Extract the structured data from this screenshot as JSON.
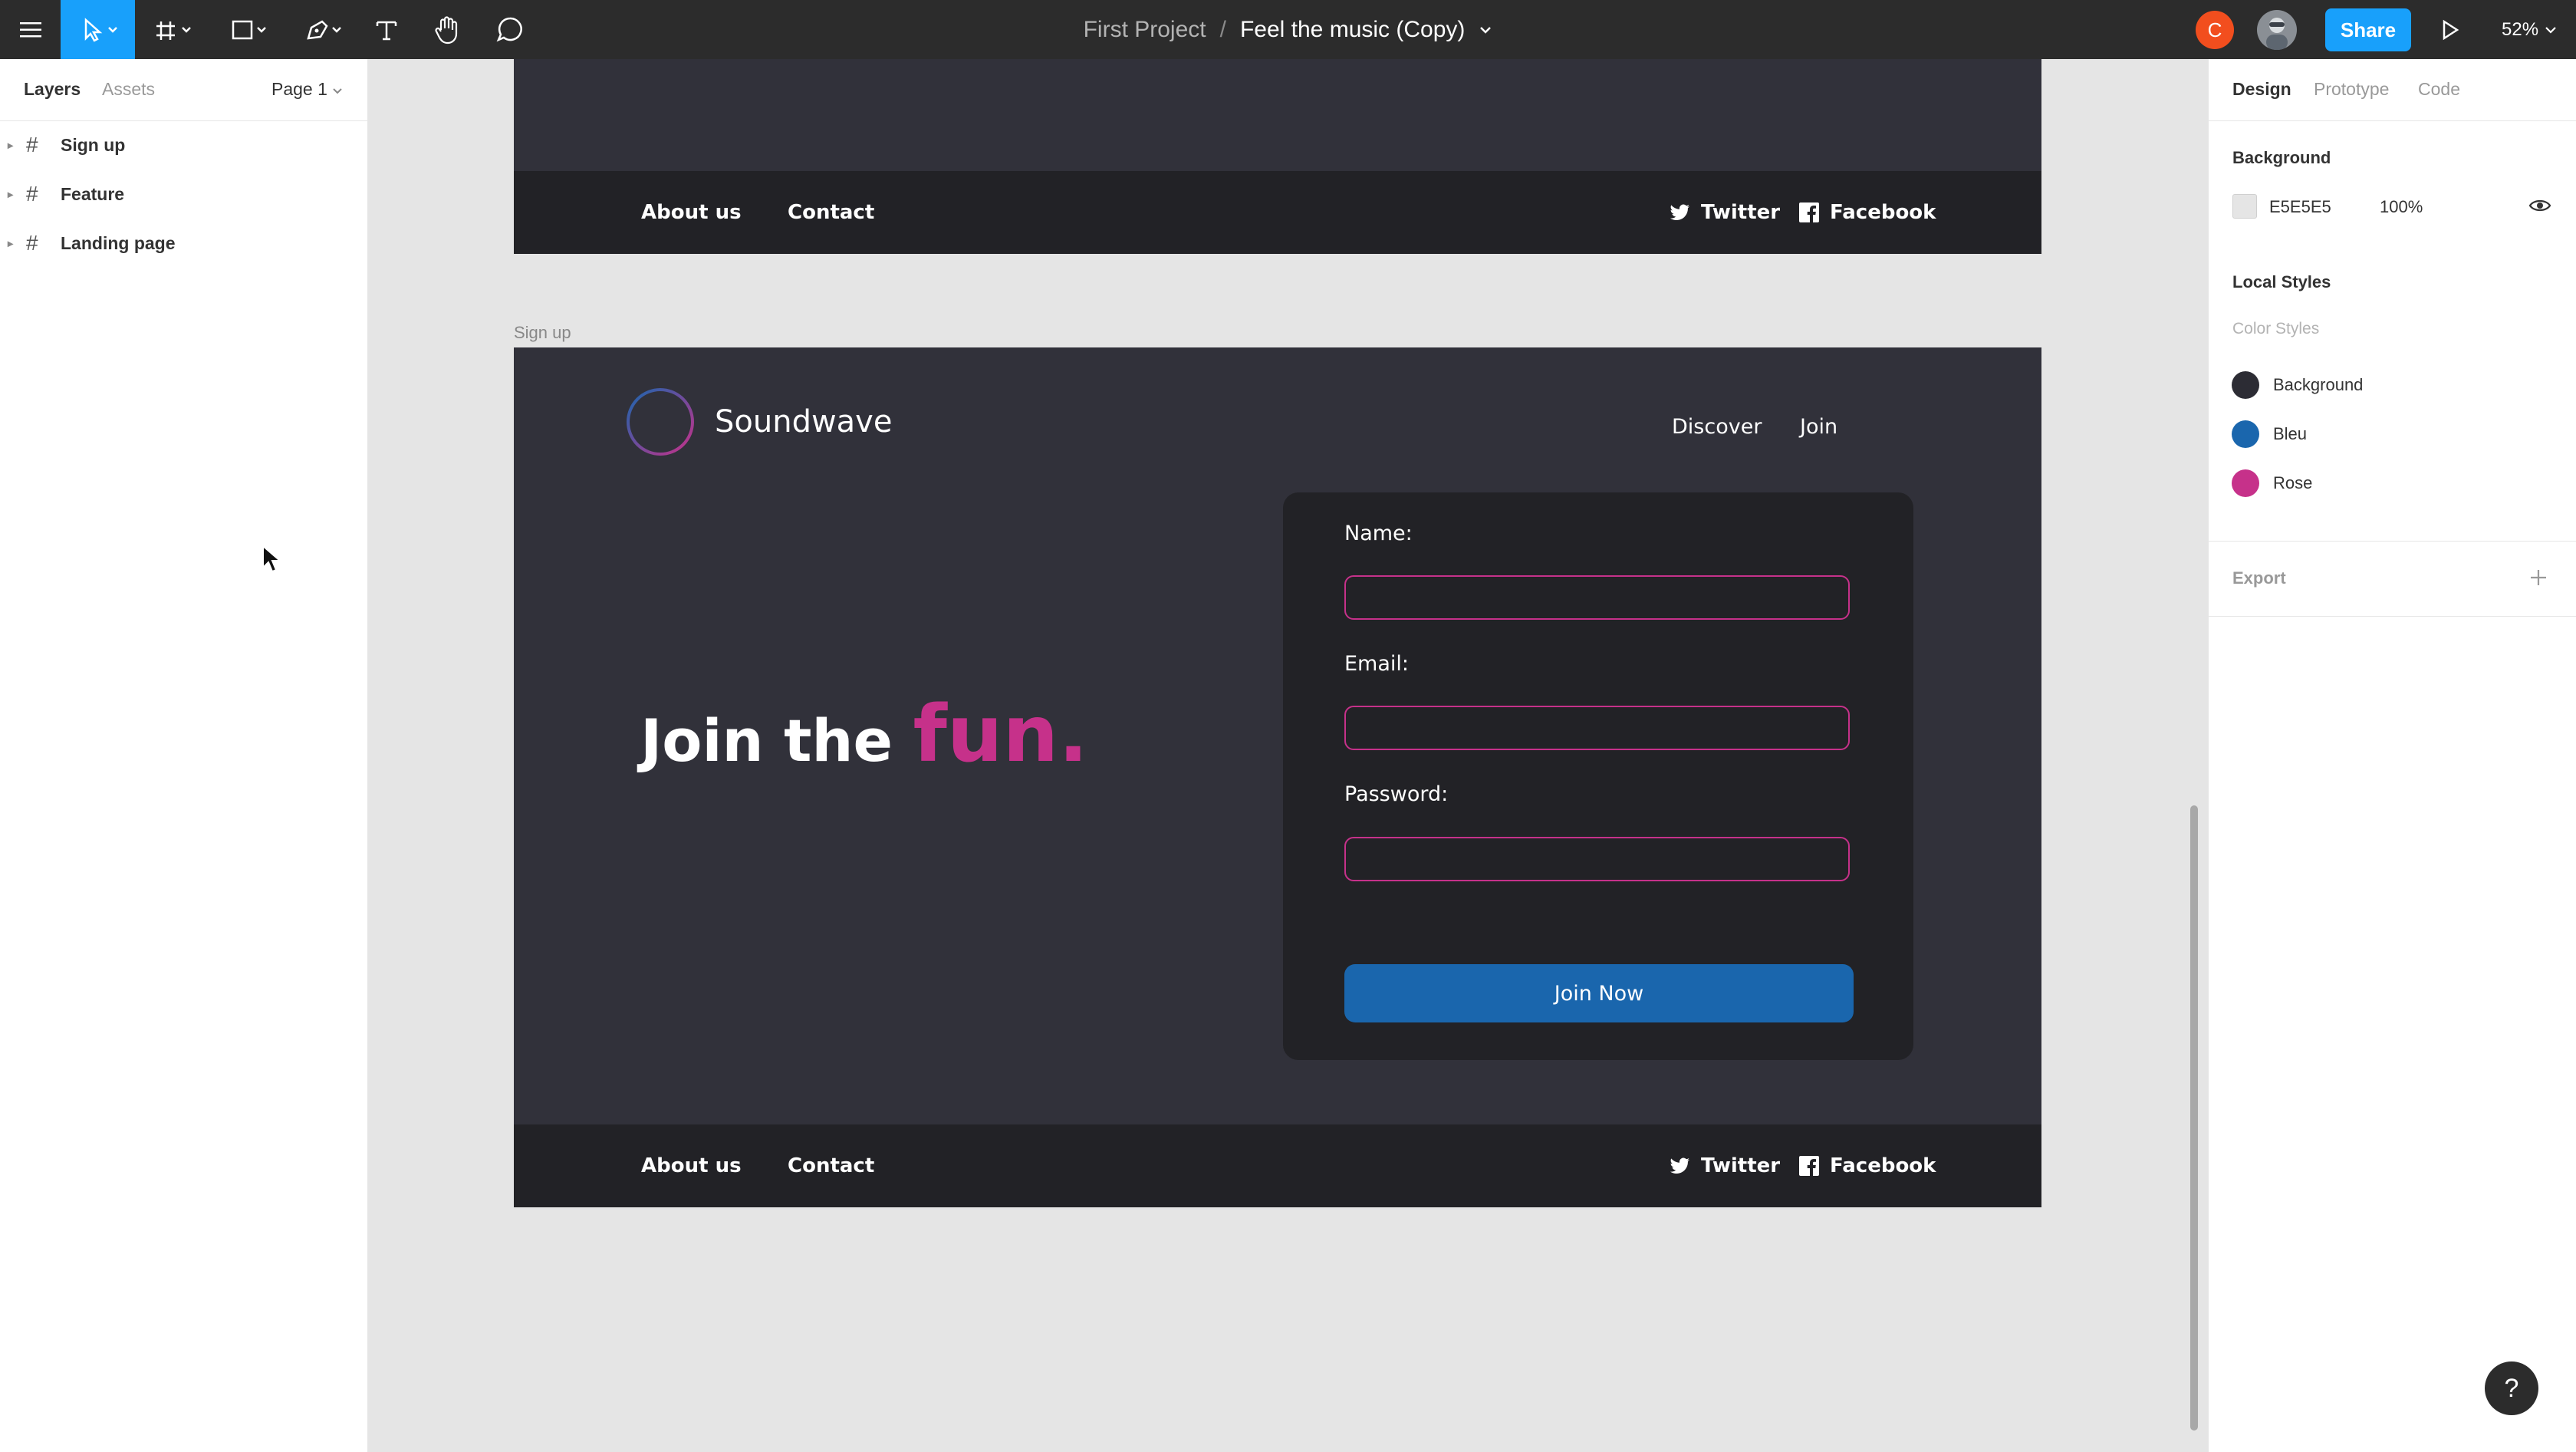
{
  "toolbar": {
    "menu_icon": "hamburger-menu-icon",
    "move_tool_icon": "move-cursor-icon",
    "frame_tool_icon": "frame-hash-icon",
    "shape_tool_icon": "rectangle-icon",
    "pen_tool_icon": "pen-icon",
    "text_tool_icon": "text-icon",
    "hand_tool_icon": "hand-icon",
    "comment_tool_icon": "comment-icon",
    "project_name": "First Project",
    "separator": "/",
    "file_name": "Feel the music (Copy)",
    "user_initial": "C",
    "share_label": "Share",
    "zoom": "52%",
    "accent_color": "#18a0fb"
  },
  "left_panel": {
    "tabs": [
      "Layers",
      "Assets"
    ],
    "page_selector": "Page 1",
    "layers": [
      {
        "label": "Sign up"
      },
      {
        "label": "Feature"
      },
      {
        "label": "Landing page"
      }
    ]
  },
  "right_panel": {
    "tabs": [
      "Design",
      "Prototype",
      "Code"
    ],
    "background_title": "Background",
    "background_hex": "E5E5E5",
    "background_opacity": "100%",
    "local_styles_title": "Local Styles",
    "color_styles_title": "Color Styles",
    "color_styles": [
      {
        "name": "Background",
        "color": "#2c2c34"
      },
      {
        "name": "Bleu",
        "color": "#1a66ad"
      },
      {
        "name": "Rose",
        "color": "#c6318a"
      }
    ],
    "export_title": "Export"
  },
  "canvas": {
    "frame_label": "Sign up",
    "footer_top": {
      "about": "About us",
      "contact": "Contact",
      "twitter": "Twitter",
      "facebook": "Facebook"
    },
    "signup": {
      "brand_name": "Soundwave",
      "nav": [
        "Discover",
        "Join"
      ],
      "hero_main": "Join the ",
      "hero_accent": "fun.",
      "form": {
        "name_label": "Name:",
        "email_label": "Email:",
        "password_label": "Password:",
        "submit_label": "Join Now"
      },
      "footer": {
        "about": "About us",
        "contact": "Contact",
        "twitter": "Twitter",
        "facebook": "Facebook"
      }
    },
    "help_label": "?"
  }
}
